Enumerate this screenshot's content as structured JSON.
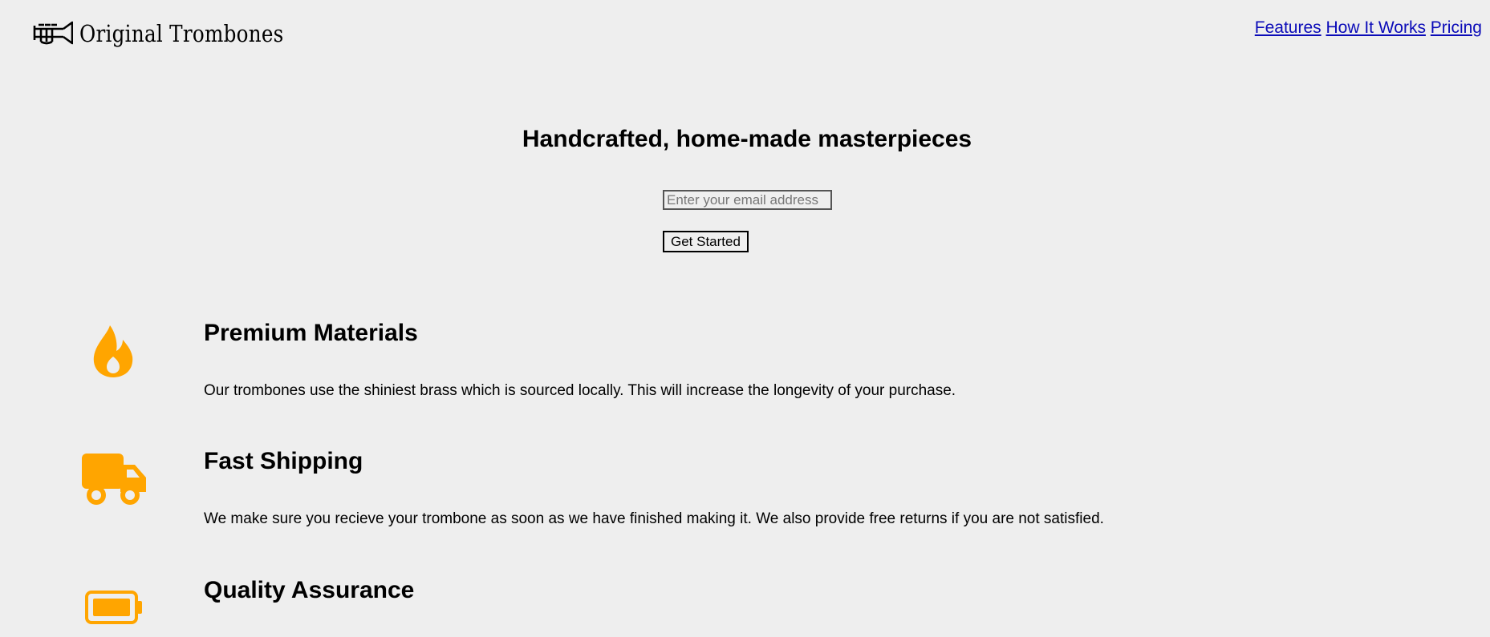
{
  "brand": {
    "name": "Original Trombones",
    "logo_icon": "trombone-icon"
  },
  "nav": {
    "links": [
      "Features",
      "How It Works",
      "Pricing"
    ]
  },
  "hero": {
    "title": "Handcrafted, home-made masterpieces",
    "email_placeholder": "Enter your email address",
    "button_label": "Get Started"
  },
  "features": [
    {
      "icon": "fire-icon",
      "title": "Premium Materials",
      "description": "Our trombones use the shiniest brass which is sourced locally. This will increase the longevity of your purchase."
    },
    {
      "icon": "truck-icon",
      "title": "Fast Shipping",
      "description": "We make sure you recieve your trombone as soon as we have finished making it. We also provide free returns if you are not satisfied."
    },
    {
      "icon": "battery-icon",
      "title": "Quality Assurance"
    }
  ],
  "colors": {
    "background": "#eeeeee",
    "icon_accent": "#ffa500",
    "link": "#0b0bb8"
  }
}
